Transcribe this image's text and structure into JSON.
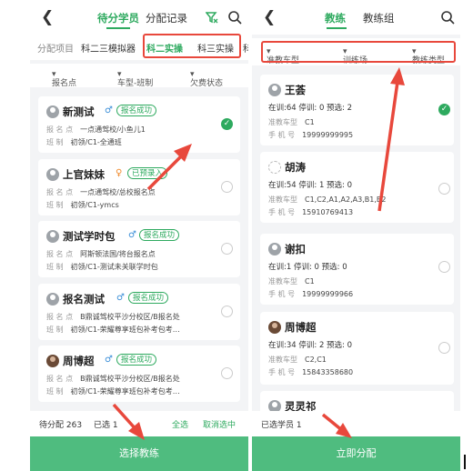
{
  "left": {
    "back_icon": "chevron-left-icon",
    "tabs": [
      "待分学员",
      "分配记录"
    ],
    "filter_icon": "filter-icon",
    "search_icon": "search-icon",
    "subtab_label": "分配项目",
    "subtabs": [
      "科二三模拟器",
      "科二实操",
      "科三实操",
      "科"
    ],
    "filters": [
      "报名点",
      "车型-班制",
      "欠费状态"
    ],
    "field_labels": {
      "school": "报 名 点",
      "class": "班    制"
    },
    "students": [
      {
        "name": "新测试",
        "gender": "male",
        "status": "报名成功",
        "school": "一点通驾校/小鱼儿1",
        "class": "初领/C1-全通班",
        "checked": true
      },
      {
        "name": "上官妹妹",
        "gender": "female",
        "status": "已预录入",
        "school": "一点通驾校/总校报名点",
        "class": "初领/C1-ymcs",
        "checked": false
      },
      {
        "name": "测试学时包",
        "gender": "male",
        "status": "报名成功",
        "school": "阿斯顿法国/将台报名点",
        "class": "初领/C1-测试未关联学时包",
        "checked": false
      },
      {
        "name": "报名测试",
        "gender": "male",
        "status": "报名成功",
        "school": "B鼎诚驾校平沙分校区/B报名处",
        "class": "初领/C1-荣耀尊享班包补考包考…",
        "checked": false
      },
      {
        "name": "周博超",
        "gender": "male",
        "status": "报名成功",
        "school": "B鼎诚驾校平沙分校区/B报名处",
        "class": "初领/C1-荣耀尊享班包补考包考…",
        "checked": false
      }
    ],
    "footer": {
      "pending": "待分配 263",
      "selected": "已选 1",
      "select_all": "全选",
      "cancel_select": "取消选中"
    },
    "cta": "选择教练"
  },
  "right": {
    "back_icon": "chevron-left-icon",
    "tabs": [
      "教练",
      "教练组"
    ],
    "search_icon": "search-icon",
    "filters": [
      "准教车型",
      "训练场",
      "教练类型"
    ],
    "field_labels": {
      "vehicle": "准教车型",
      "phone": "手 机 号"
    },
    "coaches": [
      {
        "name": "王荟",
        "stats": "在训:64 停训: 0 预选: 2",
        "vehicle": "C1",
        "phone": "19999999995",
        "checked": true
      },
      {
        "name": "胡涛",
        "stats": "在训:54 停训: 1 预选: 0",
        "vehicle": "C1,C2,A1,A2,A3,B1,B2",
        "phone": "15910769413",
        "checked": false
      },
      {
        "name": "谢扣",
        "stats": "在训:1 停训: 0 预选: 0",
        "vehicle": "C1",
        "phone": "19999999966",
        "checked": false
      },
      {
        "name": "周博超",
        "stats": "在训:34 停训: 2 预选: 0",
        "vehicle": "C2,C1",
        "phone": "15843358680",
        "checked": false
      },
      {
        "name": "灵灵祁",
        "stats": "",
        "vehicle": "",
        "phone": "",
        "checked": false
      }
    ],
    "footer": {
      "selected": "已选学员 1"
    },
    "cta": "立即分配"
  },
  "colors": {
    "accent": "#2eaa5f",
    "annotation": "#e8483c",
    "cta": "#4fbc7f"
  }
}
